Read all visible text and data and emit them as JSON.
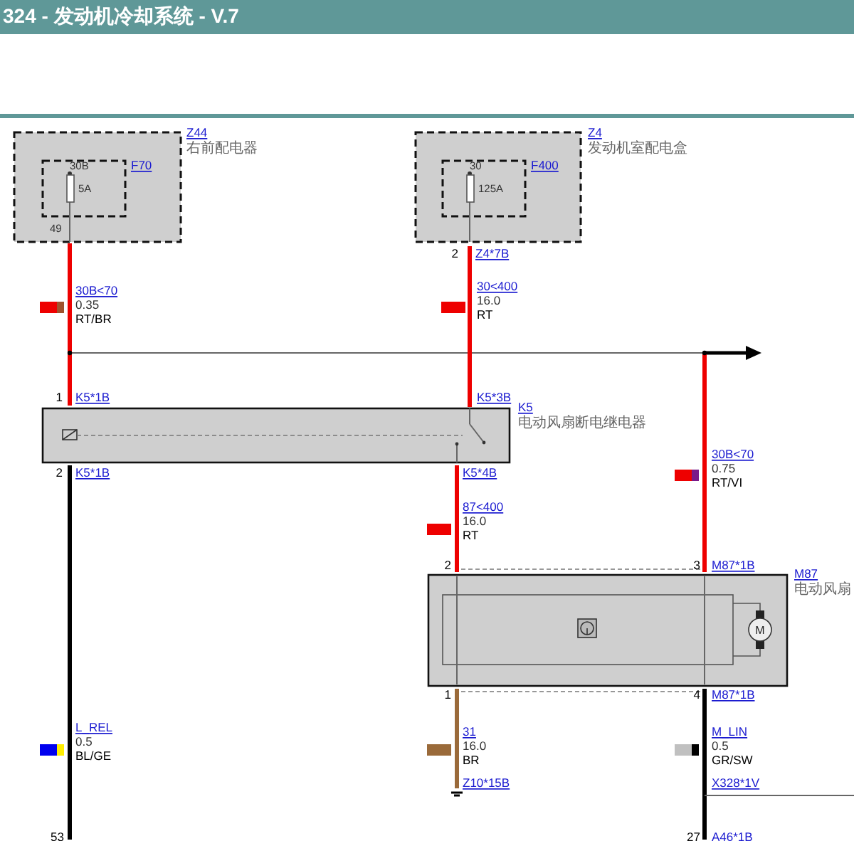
{
  "title": "324 - 发动机冷却系统 - V.7",
  "components": [
    {
      "code": "Z44",
      "name": "右前配电器"
    },
    {
      "code": "Z4",
      "name": "发动机室配电盒"
    },
    {
      "code": "K5",
      "name": "电动风扇断电继电器"
    },
    {
      "code": "M87",
      "name": "电动风扇",
      "symbol": "M"
    }
  ],
  "fuses": [
    {
      "code": "F70",
      "terminal": "30B",
      "rating": "5A",
      "pin": "49"
    },
    {
      "code": "F400",
      "terminal": "30",
      "rating": "125A"
    }
  ],
  "connectors": [
    {
      "pin": "2",
      "ref": "Z4*7B"
    },
    {
      "pin": "1",
      "ref": "K5*1B"
    },
    {
      "ref": "K5*3B"
    },
    {
      "pin": "2",
      "ref": "K5*1B"
    },
    {
      "ref": "K5*4B"
    },
    {
      "pin": "2"
    },
    {
      "pin": "3",
      "ref": "M87*1B"
    },
    {
      "pin": "1"
    },
    {
      "pin": "4",
      "ref": "M87*1B"
    },
    {
      "ref": "Z10*15B"
    },
    {
      "ref": "X328*1V"
    },
    {
      "pin": "53"
    },
    {
      "pin": "27",
      "ref": "A46*1B"
    }
  ],
  "wires": [
    {
      "kind": "power",
      "signal": "30B<70",
      "gauge": "0.35",
      "color_code": "RT/BR",
      "swatch": [
        {
          "color": "#ee0000"
        },
        {
          "color": "#a0522d"
        }
      ]
    },
    {
      "kind": "power",
      "signal": "30<400",
      "gauge": "16.0",
      "color_code": "RT",
      "swatch": [
        {
          "color": "#ee0000"
        }
      ]
    },
    {
      "kind": "power",
      "signal": "30B<70",
      "gauge": "0.75",
      "color_code": "RT/VI",
      "swatch": [
        {
          "color": "#ee0000"
        },
        {
          "color": "#7a1a8a"
        }
      ]
    },
    {
      "kind": "power",
      "signal": "87<400",
      "gauge": "16.0",
      "color_code": "RT",
      "swatch": [
        {
          "color": "#ee0000"
        }
      ]
    },
    {
      "kind": "signal",
      "signal": "L_REL",
      "gauge": "0.5",
      "color_code": "BL/GE",
      "swatch": [
        {
          "color": "#0000ee"
        },
        {
          "color": "#ffee00"
        }
      ]
    },
    {
      "kind": "ground",
      "signal": "31",
      "gauge": "16.0",
      "color_code": "BR",
      "swatch": [
        {
          "color": "#9a6a3a"
        }
      ]
    },
    {
      "kind": "signal",
      "signal": "M_LIN",
      "gauge": "0.5",
      "color_code": "GR/SW",
      "swatch": [
        {
          "color": "#c0c0c0"
        },
        {
          "color": "#000000"
        }
      ]
    }
  ]
}
